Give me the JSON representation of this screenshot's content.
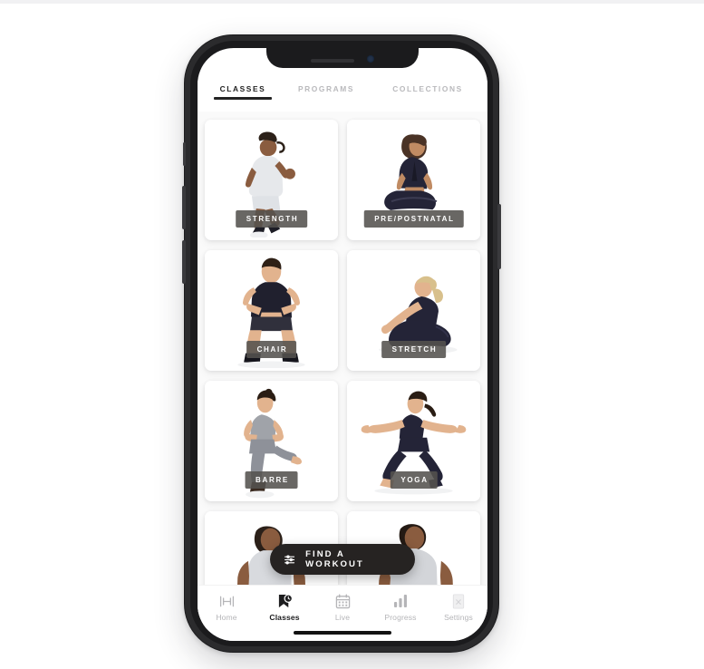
{
  "app": {
    "device": "smartphone",
    "status_icons": {
      "speaker": "speaker-slit",
      "camera": "front-camera-dot"
    }
  },
  "tabs": [
    {
      "label": "CLASSES",
      "active": true
    },
    {
      "label": "PROGRAMS",
      "active": false
    },
    {
      "label": "COLLECTIONS",
      "active": false
    }
  ],
  "categories": [
    {
      "label": "STRENGTH",
      "photo": "man-running-in-place-gray-tank"
    },
    {
      "label": "PRE/POSTNATAL",
      "photo": "woman-seated-prayer-pose-black-outfit"
    },
    {
      "label": "CHAIR",
      "photo": "man-squatting-chair-pose-black-tank"
    },
    {
      "label": "STRETCH",
      "photo": "woman-seated-forward-fold-stretch"
    },
    {
      "label": "BARRE",
      "photo": "woman-barre-leg-lift-gray-outfit"
    },
    {
      "label": "YOGA",
      "photo": "woman-warrior-two-pose-navy-outfit"
    },
    {
      "label": "",
      "photo": "man-partial-row-cutoff"
    },
    {
      "label": "",
      "photo": "woman-partial-row-cutoff"
    }
  ],
  "cta": {
    "label": "FIND A WORKOUT",
    "icon": "sliders-filter-icon"
  },
  "bottom_nav": [
    {
      "label": "Home",
      "icon": "dumbbell-icon",
      "active": false
    },
    {
      "label": "Classes",
      "icon": "bookmark-clock-icon",
      "active": true
    },
    {
      "label": "Live",
      "icon": "calendar-icon",
      "active": false
    },
    {
      "label": "Progress",
      "icon": "bar-chart-icon",
      "active": false
    },
    {
      "label": "Settings",
      "icon": "placeholder-image-icon",
      "active": false
    }
  ],
  "colors": {
    "page_background": "#ffffff",
    "screen_background": "#fafafa",
    "card_background": "#ffffff",
    "chip_background": "#54524f",
    "accent_dark": "#232323",
    "cta_background": "#262322",
    "inactive_text": "#b9b9bc",
    "device_frame": "#2b2b2d"
  }
}
